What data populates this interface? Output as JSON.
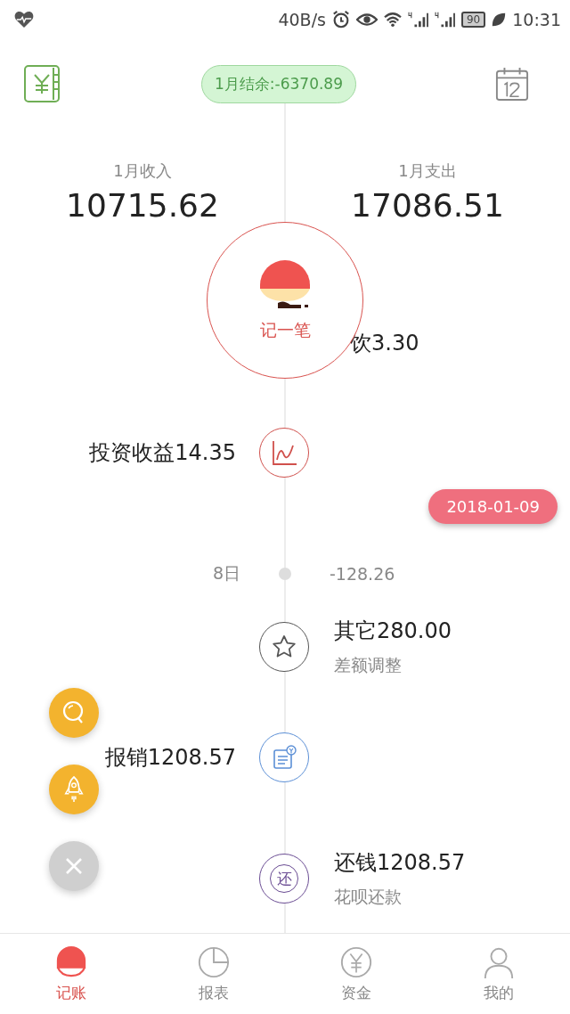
{
  "status_bar": {
    "speed": "40B/s",
    "battery": "90",
    "time": "10:31"
  },
  "header": {
    "balance": "1月结余:-6370.89"
  },
  "summary": [
    {
      "label": "1月收入",
      "amount": "10715.62"
    },
    {
      "label": "1月支出",
      "amount": "17086.51"
    }
  ],
  "record_button": {
    "label": "记一笔"
  },
  "timeline": [
    {
      "kind": "dining",
      "title": "饮3.30"
    },
    {
      "kind": "invest",
      "title": "投资收益14.35",
      "color": "#d0504c"
    },
    {
      "kind": "date",
      "label": "2018-01-09"
    },
    {
      "kind": "day",
      "label": "8日",
      "total": "-128.26"
    },
    {
      "kind": "other",
      "title": "其它280.00",
      "note": "差额调整",
      "color": "#555555"
    },
    {
      "kind": "reimburse",
      "title": "报销1208.57",
      "color": "#5b8fd6"
    },
    {
      "kind": "repay",
      "title": "还钱1208.57",
      "note": "花呗还款",
      "icon_text": "还",
      "color": "#6a4c93"
    }
  ],
  "floating_buttons": [
    {
      "kind": "search"
    },
    {
      "kind": "rocket"
    },
    {
      "kind": "close"
    }
  ],
  "tabs": [
    {
      "label": "记账",
      "selected": true
    },
    {
      "label": "报表",
      "selected": false
    },
    {
      "label": "资金",
      "selected": false
    },
    {
      "label": "我的",
      "selected": false
    }
  ]
}
